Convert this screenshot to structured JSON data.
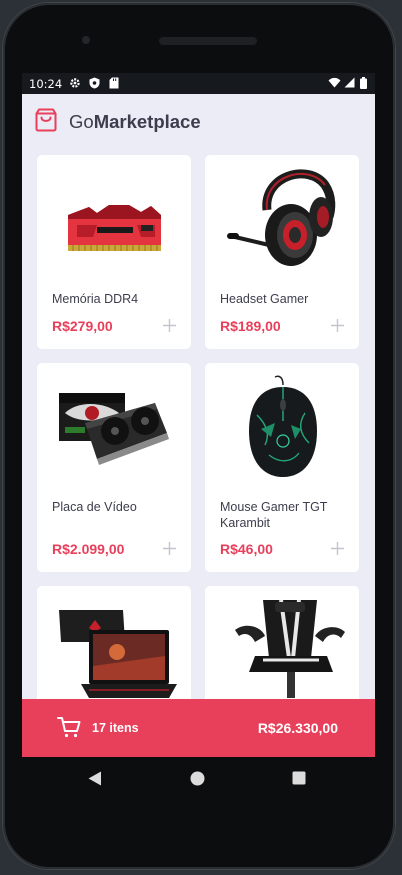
{
  "status": {
    "time": "10:24",
    "left_icons": [
      "gear-icon",
      "shield-icon",
      "sd-card-icon"
    ],
    "right_icons": [
      "wifi-icon",
      "signal-icon",
      "battery-icon"
    ]
  },
  "header": {
    "brand_prefix": "Go",
    "brand_bold": "Marketplace",
    "icon": "shopping-bag-icon"
  },
  "products": [
    {
      "title": "Memória DDR4",
      "price": "R$279,00",
      "image": "ram-memory-image"
    },
    {
      "title": "Headset Gamer",
      "price": "R$189,00",
      "image": "headset-image"
    },
    {
      "title": "Placa de Vídeo",
      "price": "R$2.099,00",
      "image": "graphics-card-image"
    },
    {
      "title": "Mouse Gamer TGT Karambit",
      "price": "R$46,00",
      "image": "gaming-mouse-image"
    },
    {
      "title": "",
      "price": "",
      "image": "laptop-image"
    },
    {
      "title": "",
      "price": "",
      "image": "gaming-chair-image"
    }
  ],
  "cart": {
    "count_label": "17 itens",
    "total": "R$26.330,00",
    "icon": "cart-icon"
  },
  "colors": {
    "accent": "#e83f5b",
    "background": "#ebecf6",
    "text": "#3d3d4d"
  }
}
